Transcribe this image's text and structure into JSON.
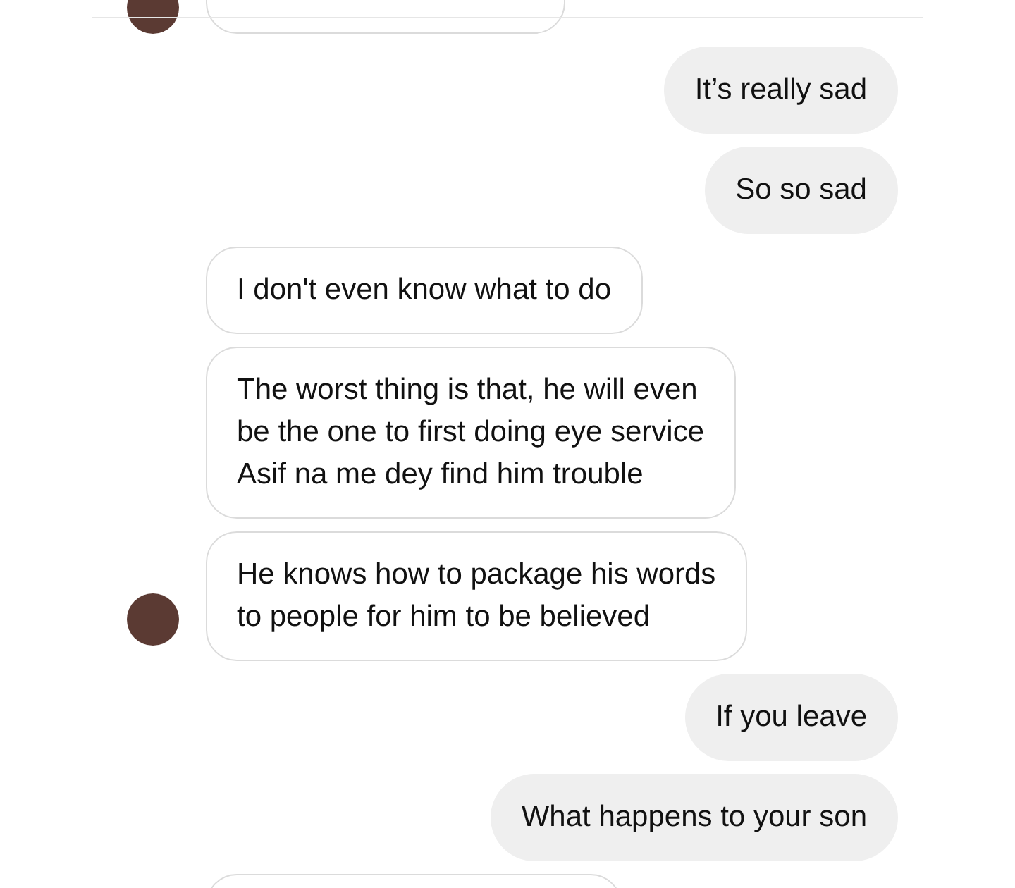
{
  "messages": [
    {
      "kind": "received",
      "avatar": true
    },
    {
      "kind": "sent",
      "text": "It’s really sad"
    },
    {
      "kind": "sent",
      "text": "So so sad"
    },
    {
      "kind": "received",
      "text": "I don't even know what to do",
      "avatar": false
    },
    {
      "kind": "received",
      "text": "The worst thing is that, he will even\nbe the one to first doing eye service\nAsif na me dey find him trouble",
      "avatar": false
    },
    {
      "kind": "received",
      "text": "He knows how to package his words\nto people for him to be believed",
      "avatar": true
    },
    {
      "kind": "sent",
      "text": "If you leave"
    },
    {
      "kind": "sent",
      "text": "What happens to your son"
    },
    {
      "kind": "received",
      "avatar": false
    }
  ]
}
